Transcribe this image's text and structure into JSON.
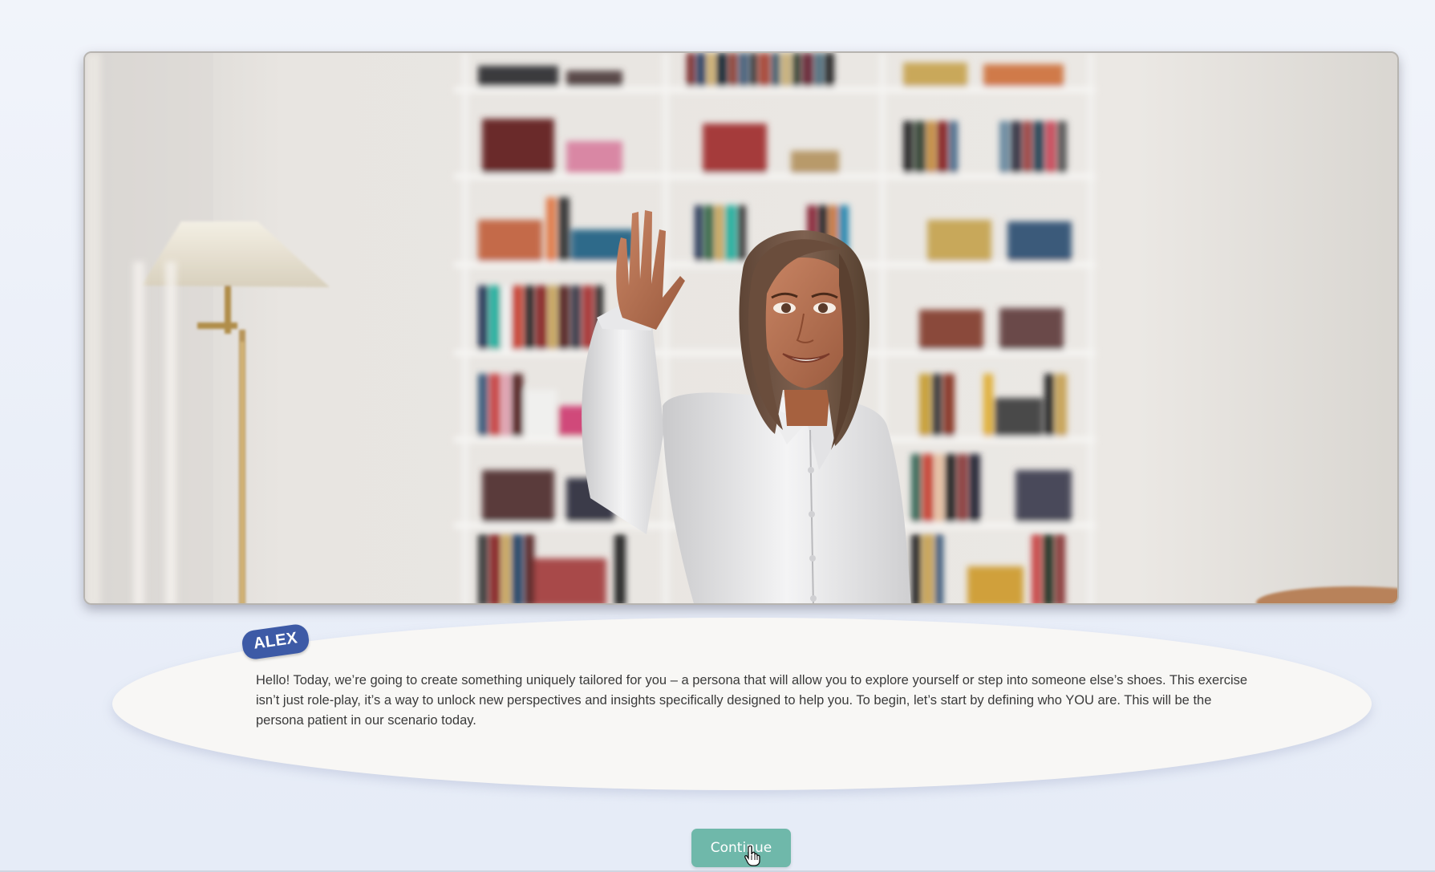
{
  "character": {
    "name": "ALEX"
  },
  "dialog": {
    "text": "Hello! Today, we’re going to create something uniquely tailored for you – a persona that will allow you to explore yourself or step into someone else’s shoes. This exercise isn’t just role-play, it’s a way to unlock new perspectives and insights specifically designed to help you. To begin, let’s start by defining who YOU are. This will be the persona patient in our scenario today."
  },
  "actions": {
    "continue_label": "Continue"
  },
  "colors": {
    "name_tag": "#3d5aa6",
    "continue_button": "#6fb8aa",
    "bubble": "#f8f7f5"
  },
  "icons": {
    "cursor": "hand-pointer-icon"
  }
}
